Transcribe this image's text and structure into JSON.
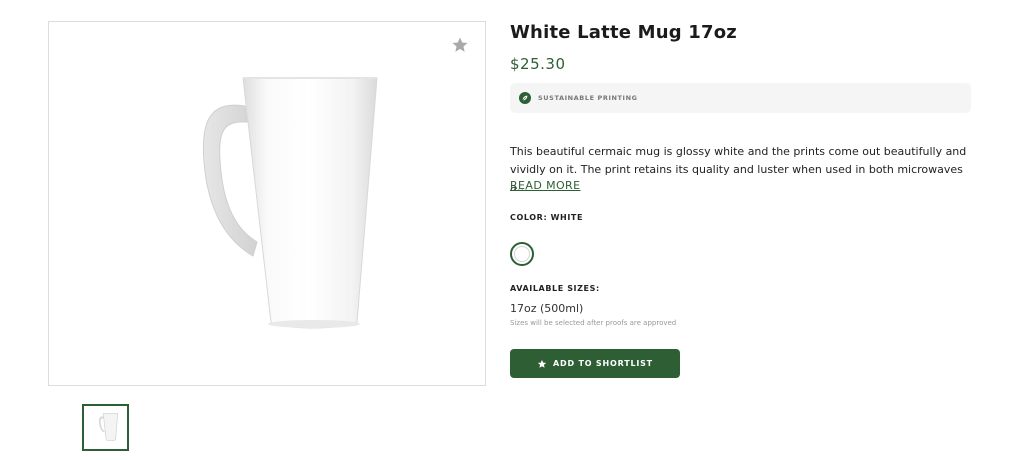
{
  "product": {
    "title": "White Latte Mug 17oz",
    "price": "$25.30",
    "badge": "SUSTAINABLE PRINTING",
    "description": "This beautiful cermaic mug is glossy white and the prints come out beautifully and vividly on it. The print retains its quality and luster when used in both microwaves a…",
    "read_more": "READ MORE"
  },
  "color": {
    "label": "COLOR: WHITE",
    "selected": "White",
    "swatch_hex": "#ffffff"
  },
  "sizes": {
    "label": "AVAILABLE SIZES:",
    "value": "17oz (500ml)",
    "note": "Sizes will be selected after proofs are approved"
  },
  "actions": {
    "shortlist_label": "ADD TO SHORTLIST"
  },
  "icons": {
    "favorite": "star-icon",
    "badge": "leaf-icon",
    "button": "star-icon"
  },
  "colors": {
    "accent": "#2d5e34",
    "badge_bg": "#f5f5f5"
  }
}
